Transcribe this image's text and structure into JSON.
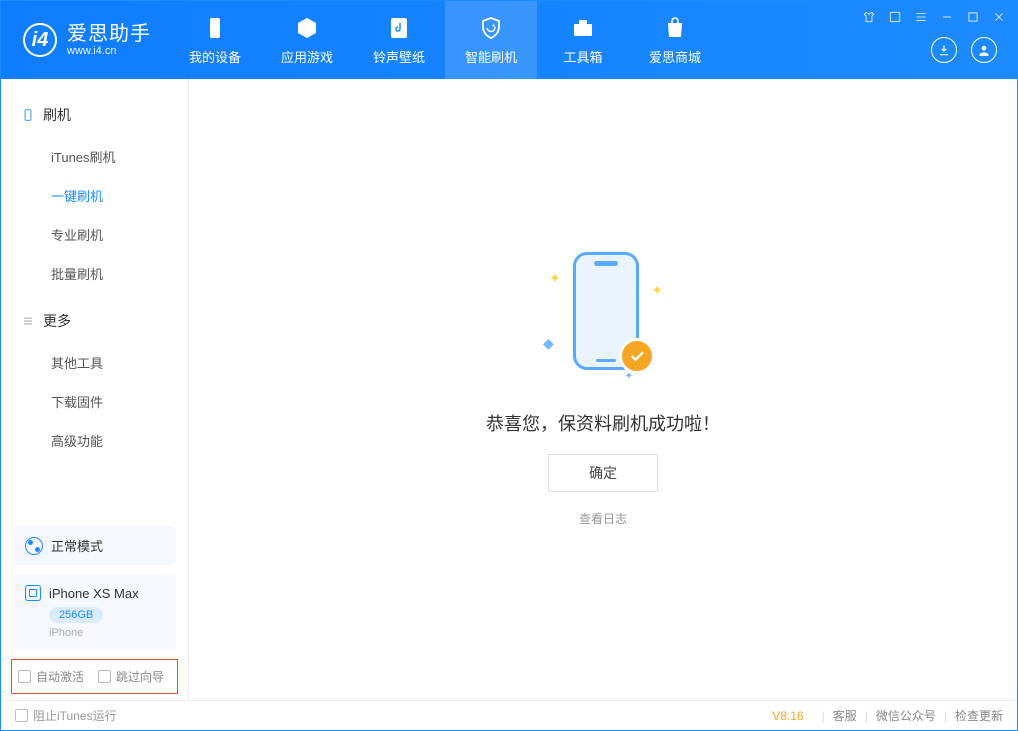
{
  "app": {
    "title": "爱思助手",
    "subtitle": "www.i4.cn"
  },
  "nav": {
    "items": [
      {
        "label": "我的设备"
      },
      {
        "label": "应用游戏"
      },
      {
        "label": "铃声壁纸"
      },
      {
        "label": "智能刷机"
      },
      {
        "label": "工具箱"
      },
      {
        "label": "爱思商城"
      }
    ]
  },
  "sidebar": {
    "group1_title": "刷机",
    "group1_items": [
      "iTunes刷机",
      "一键刷机",
      "专业刷机",
      "批量刷机"
    ],
    "group2_title": "更多",
    "group2_items": [
      "其他工具",
      "下载固件",
      "高级功能"
    ],
    "mode_label": "正常模式",
    "device_name": "iPhone XS Max",
    "device_storage": "256GB",
    "device_type": "iPhone",
    "checkbox_auto_activate": "自动激活",
    "checkbox_skip_wizard": "跳过向导"
  },
  "main": {
    "success_message": "恭喜您，保资料刷机成功啦！",
    "ok_button": "确定",
    "view_log": "查看日志"
  },
  "footer": {
    "block_itunes": "阻止iTunes运行",
    "version": "V8.16",
    "links": [
      "客服",
      "微信公众号",
      "检查更新"
    ]
  }
}
